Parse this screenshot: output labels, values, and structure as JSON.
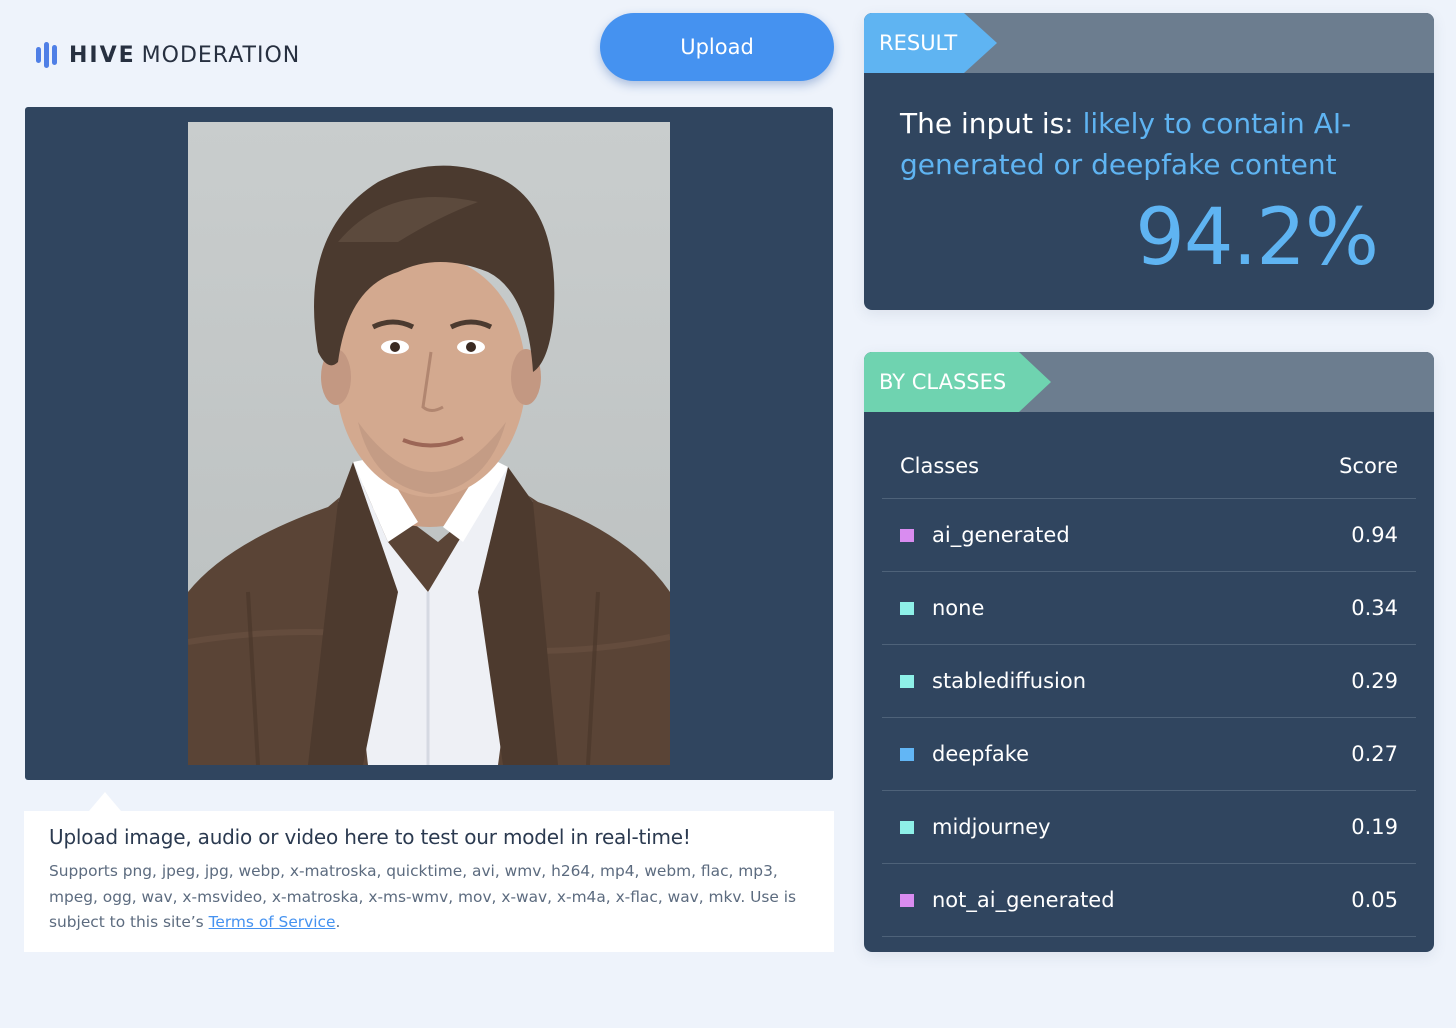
{
  "brand": {
    "bold": "HIVE",
    "light": "MODERATION"
  },
  "upload_label": "Upload",
  "caption": {
    "title": "Upload image, audio or video here to test our model in real-time!",
    "text": "Supports png, jpeg, jpg, webp, x-matroska, quicktime, avi, wmv, h264, mp4, webm, flac, mp3, mpeg, ogg, wav, x-msvideo, x-matroska, x-ms-wmv, mov, x-wav, x-m4a, x-flac, wav, mkv. Use is subject to this site’s ",
    "link": "Terms of Service",
    "end": "."
  },
  "result": {
    "tab": "RESULT",
    "prefix": "The input is: ",
    "verdict": "likely to contain AI-generated or deepfake content",
    "percent": "94.2%"
  },
  "classes": {
    "tab": "BY CLASSES",
    "col_class": "Classes",
    "col_score": "Score",
    "rows": [
      {
        "name": "ai_generated",
        "score": "0.94",
        "color": "#d98cf0"
      },
      {
        "name": "none",
        "score": "0.34",
        "color": "#8ef0e8"
      },
      {
        "name": "stablediffusion",
        "score": "0.29",
        "color": "#8ef0e8"
      },
      {
        "name": "deepfake",
        "score": "0.27",
        "color": "#62b6f5"
      },
      {
        "name": "midjourney",
        "score": "0.19",
        "color": "#8ef0e8"
      },
      {
        "name": "not_ai_generated",
        "score": "0.05",
        "color": "#d98cf0"
      }
    ]
  }
}
